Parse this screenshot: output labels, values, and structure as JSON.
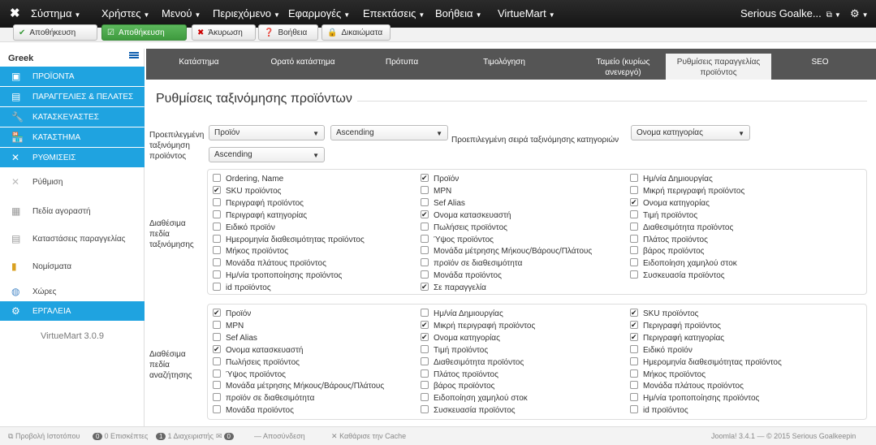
{
  "topbar": {
    "menu": [
      {
        "label": "Σύστημα"
      },
      {
        "label": "Χρήστες"
      },
      {
        "label": "Μενού"
      },
      {
        "label": "Περιεχόμενο"
      },
      {
        "label": "Εφαρμογές"
      },
      {
        "label": "Επεκτάσεις"
      },
      {
        "label": "Βοήθεια"
      },
      {
        "label": "VirtueMart"
      }
    ],
    "site_name": "Serious Goalke..."
  },
  "toolbar": {
    "save_label": "Αποθήκευση",
    "save_close_label": "Αποθήκευση",
    "cancel_label": "Άκυρωση",
    "help_label": "Βοήθεια",
    "permissions_label": "Δικαιώματα"
  },
  "sidebar": {
    "language": "Greek",
    "items": [
      {
        "label": "ΠΡΟΪΟΝΤΑ"
      },
      {
        "label": "ΠΑΡΑΓΓΕΛΙΕΣ & ΠΕΛΑΤΕΣ"
      },
      {
        "label": "ΚΑΤΑΣΚΕΥΑΣΤΕΣ"
      },
      {
        "label": "ΚΑΤΑΣΤΗΜΑ"
      },
      {
        "label": "ΡΥΘΜΙΣΕΙΣ"
      },
      {
        "label": "Ρύθμιση"
      },
      {
        "label": "Πεδία αγοραστή"
      },
      {
        "label": "Καταστάσεις παραγγελίας"
      },
      {
        "label": "Νομίσματα"
      },
      {
        "label": "Χώρες"
      },
      {
        "label": "ΕΡΓΑΛΕΙΑ"
      }
    ],
    "version": "VirtueMart 3.0.9"
  },
  "tabs": [
    {
      "label": "Κατάστημα"
    },
    {
      "label": "Ορατό κατάστημα"
    },
    {
      "label": "Πρότυπα"
    },
    {
      "label": "Τιμολόγηση"
    },
    {
      "label": "Ταμείο (κυρίως ανενεργό)"
    },
    {
      "label": "Ρυθμίσεις παραγγελίας προϊόντος"
    },
    {
      "label": "SEO"
    }
  ],
  "section_title": "Ρυθμίσεις ταξινόμησης προϊόντων",
  "default_order": {
    "label": "Προεπιλεγμένη ταξινόμηση προϊόντος",
    "field_value": "Προϊόν",
    "direction_value": "Ascending",
    "direction2_value": "Ascending",
    "category_label": "Προεπιλεγμένη σειρά ταξινόμησης κατηγοριών",
    "category_value": "Ονομα κατηγορίας"
  },
  "sort_fields": {
    "label": "Διαθέσιμα πεδία ταξινόμησης",
    "col1": [
      {
        "label": "Ordering, Name",
        "checked": false
      },
      {
        "label": "SKU προϊόντος",
        "checked": true
      },
      {
        "label": "Περιγραφή προϊόντος",
        "checked": false
      },
      {
        "label": "Περιγραφή κατηγορίας",
        "checked": false
      },
      {
        "label": "Ειδικό προϊόν",
        "checked": false
      },
      {
        "label": "Ημερομηνία διαθεσιμότητας προϊόντος",
        "checked": false
      },
      {
        "label": "Μήκος προϊόντος",
        "checked": false
      },
      {
        "label": "Μονάδα πλάτους προϊόντος",
        "checked": false
      },
      {
        "label": "Ημ/νία τροποποίησης προϊόντος",
        "checked": false
      },
      {
        "label": "id προϊόντος",
        "checked": false
      }
    ],
    "col2": [
      {
        "label": "Προϊόν",
        "checked": true
      },
      {
        "label": "MPN",
        "checked": false
      },
      {
        "label": "Sef Alias",
        "checked": false
      },
      {
        "label": "Ονομα κατασκευαστή",
        "checked": true
      },
      {
        "label": "Πωλήσεις προϊόντος",
        "checked": false
      },
      {
        "label": "Ύψος προϊόντος",
        "checked": false
      },
      {
        "label": "Μονάδα μέτρησης Μήκους/Βάρους/Πλάτους",
        "checked": false
      },
      {
        "label": "προϊόν σε διαθεσιμότητα",
        "checked": false
      },
      {
        "label": "Μονάδα προϊόντος",
        "checked": false
      },
      {
        "label": "Σε παραγγελία",
        "checked": true
      }
    ],
    "col3": [
      {
        "label": "Ημ/νία Δημιουργίας",
        "checked": false
      },
      {
        "label": "Μικρή περιγραφή προϊόντος",
        "checked": false
      },
      {
        "label": "Ονομα κατηγορίας",
        "checked": true
      },
      {
        "label": "Τιμή προϊόντος",
        "checked": false
      },
      {
        "label": "Διαθεσιμότητα προϊόντος",
        "checked": false
      },
      {
        "label": "Πλάτος προϊόντος",
        "checked": false
      },
      {
        "label": "βάρος προϊόντος",
        "checked": false
      },
      {
        "label": "Ειδοποίηση χαμηλού στοκ",
        "checked": false
      },
      {
        "label": "Συσκευασία προϊόντος",
        "checked": false
      }
    ]
  },
  "search_fields": {
    "label": "Διαθέσιμα πεδία αναζήτησης",
    "col1": [
      {
        "label": "Προϊόν",
        "checked": true
      },
      {
        "label": "MPN",
        "checked": false
      },
      {
        "label": "Sef Alias",
        "checked": false
      },
      {
        "label": "Ονομα κατασκευαστή",
        "checked": true
      },
      {
        "label": "Πωλήσεις προϊόντος",
        "checked": false
      },
      {
        "label": "Ύψος προϊόντος",
        "checked": false
      },
      {
        "label": "Μονάδα μέτρησης Μήκους/Βάρους/Πλάτους",
        "checked": false
      },
      {
        "label": "προϊόν σε διαθεσιμότητα",
        "checked": false
      },
      {
        "label": "Μονάδα προϊόντος",
        "checked": false
      }
    ],
    "col2": [
      {
        "label": "Ημ/νία Δημιουργίας",
        "checked": false
      },
      {
        "label": "Μικρή περιγραφή προϊόντος",
        "checked": true
      },
      {
        "label": "Ονομα κατηγορίας",
        "checked": true
      },
      {
        "label": "Τιμή προϊόντος",
        "checked": false
      },
      {
        "label": "Διαθεσιμότητα προϊόντος",
        "checked": false
      },
      {
        "label": "Πλάτος προϊόντος",
        "checked": false
      },
      {
        "label": "βάρος προϊόντος",
        "checked": false
      },
      {
        "label": "Ειδοποίηση χαμηλού στοκ",
        "checked": false
      },
      {
        "label": "Συσκευασία προϊόντος",
        "checked": false
      }
    ],
    "col3": [
      {
        "label": "SKU προϊόντος",
        "checked": true
      },
      {
        "label": "Περιγραφή προϊόντος",
        "checked": true
      },
      {
        "label": "Περιγραφή κατηγορίας",
        "checked": true
      },
      {
        "label": "Ειδικό προϊόν",
        "checked": false
      },
      {
        "label": "Ημερομηνία διαθεσιμότητας προϊόντος",
        "checked": false
      },
      {
        "label": "Μήκος προϊόντος",
        "checked": false
      },
      {
        "label": "Μονάδα πλάτους προϊόντος",
        "checked": false
      },
      {
        "label": "Ημ/νία τροποποίησης προϊόντος",
        "checked": false
      },
      {
        "label": "id προϊόντος",
        "checked": false
      }
    ]
  },
  "statusbar": {
    "view_site": "Προβολή Ιστοτόπου",
    "visitors_count": "0",
    "visitors_label": "0 Επισκέπτες",
    "admins_count": "1",
    "admins_label": "1 Διαχειριστής",
    "messages_count": "0",
    "logout": "Αποσύνδεση",
    "clear_cache": "Καθάρισε την Cache",
    "copyright": "Joomla! 3.4.1 — © 2015 Serious Goalkeepin"
  }
}
